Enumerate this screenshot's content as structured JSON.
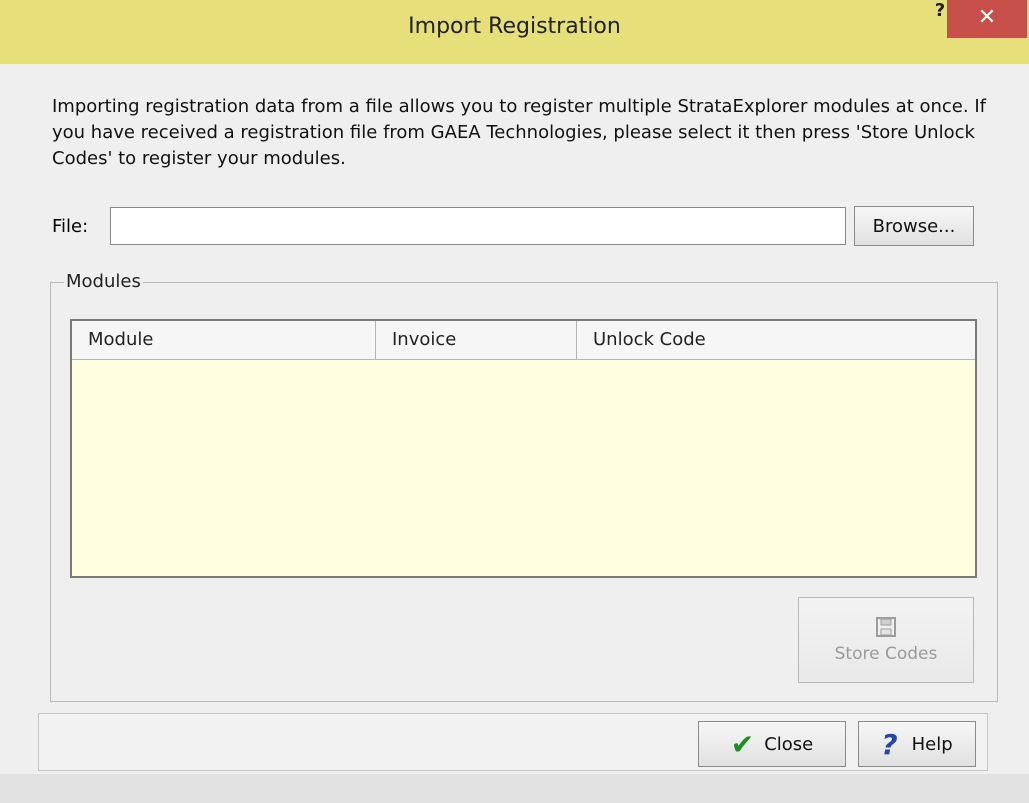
{
  "window": {
    "title": "Import Registration",
    "help_glyph": "?",
    "close_glyph": "✕"
  },
  "intro": {
    "text": "Importing registration data from a file allows you to register multiple StrataExplorer modules at once. If you have received a registration file from GAEA Technologies, please select it then press 'Store Unlock Codes' to register your modules."
  },
  "file": {
    "label": "File:",
    "value": "",
    "placeholder": ""
  },
  "buttons": {
    "browse": "Browse...",
    "store": "Store Codes",
    "close": "Close",
    "help": "Help"
  },
  "modules": {
    "legend": "Modules",
    "columns": [
      "Module",
      "Invoice",
      "Unlock Code"
    ],
    "rows": []
  },
  "icons": {
    "check": "check-icon",
    "help": "question-icon",
    "floppy": "floppy-disk-icon"
  }
}
